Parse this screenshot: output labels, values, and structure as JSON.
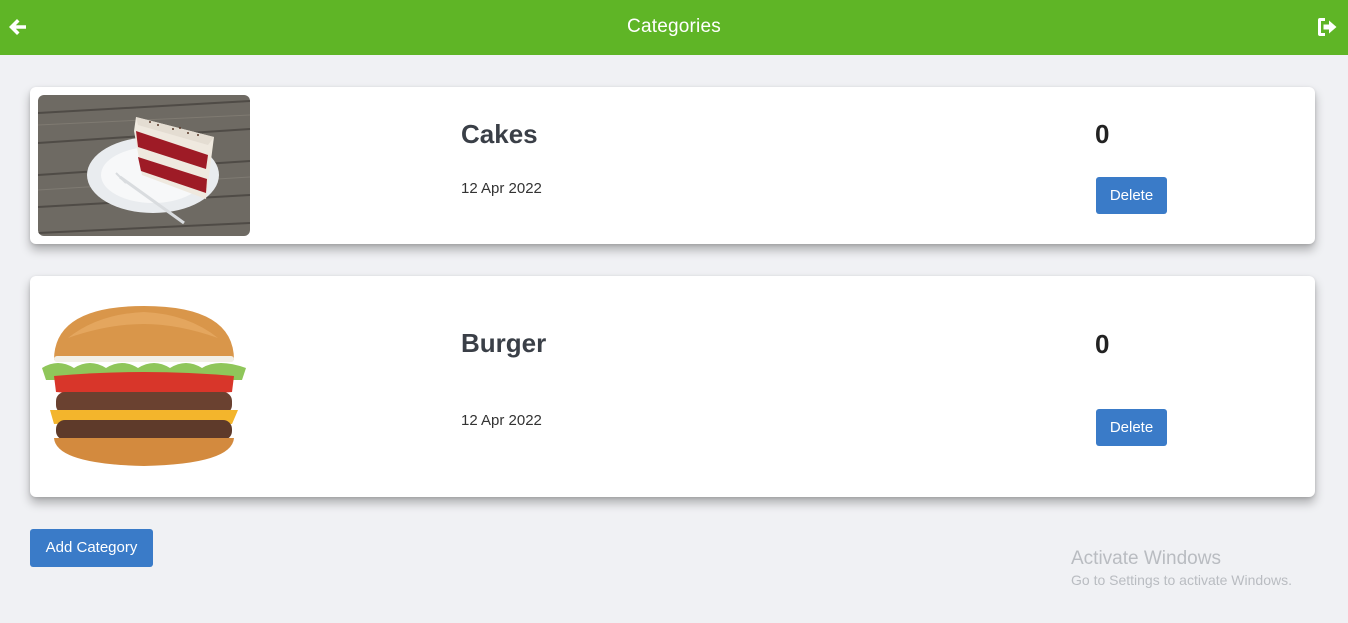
{
  "header": {
    "title": "Categories",
    "back_icon": "arrow-left-icon",
    "logout_icon": "sign-out-icon",
    "color": "#5fb526"
  },
  "categories": [
    {
      "name": "Cakes",
      "date": "12 Apr 2022",
      "count": "0",
      "delete_label": "Delete",
      "image": "cake-slice-image"
    },
    {
      "name": "Burger",
      "date": "12 Apr 2022",
      "count": "0",
      "delete_label": "Delete",
      "image": "burger-image"
    }
  ],
  "actions": {
    "add_label": "Add Category",
    "button_color": "#3a7bc8"
  },
  "watermark": {
    "title": "Activate Windows",
    "subtitle": "Go to Settings to activate Windows."
  }
}
